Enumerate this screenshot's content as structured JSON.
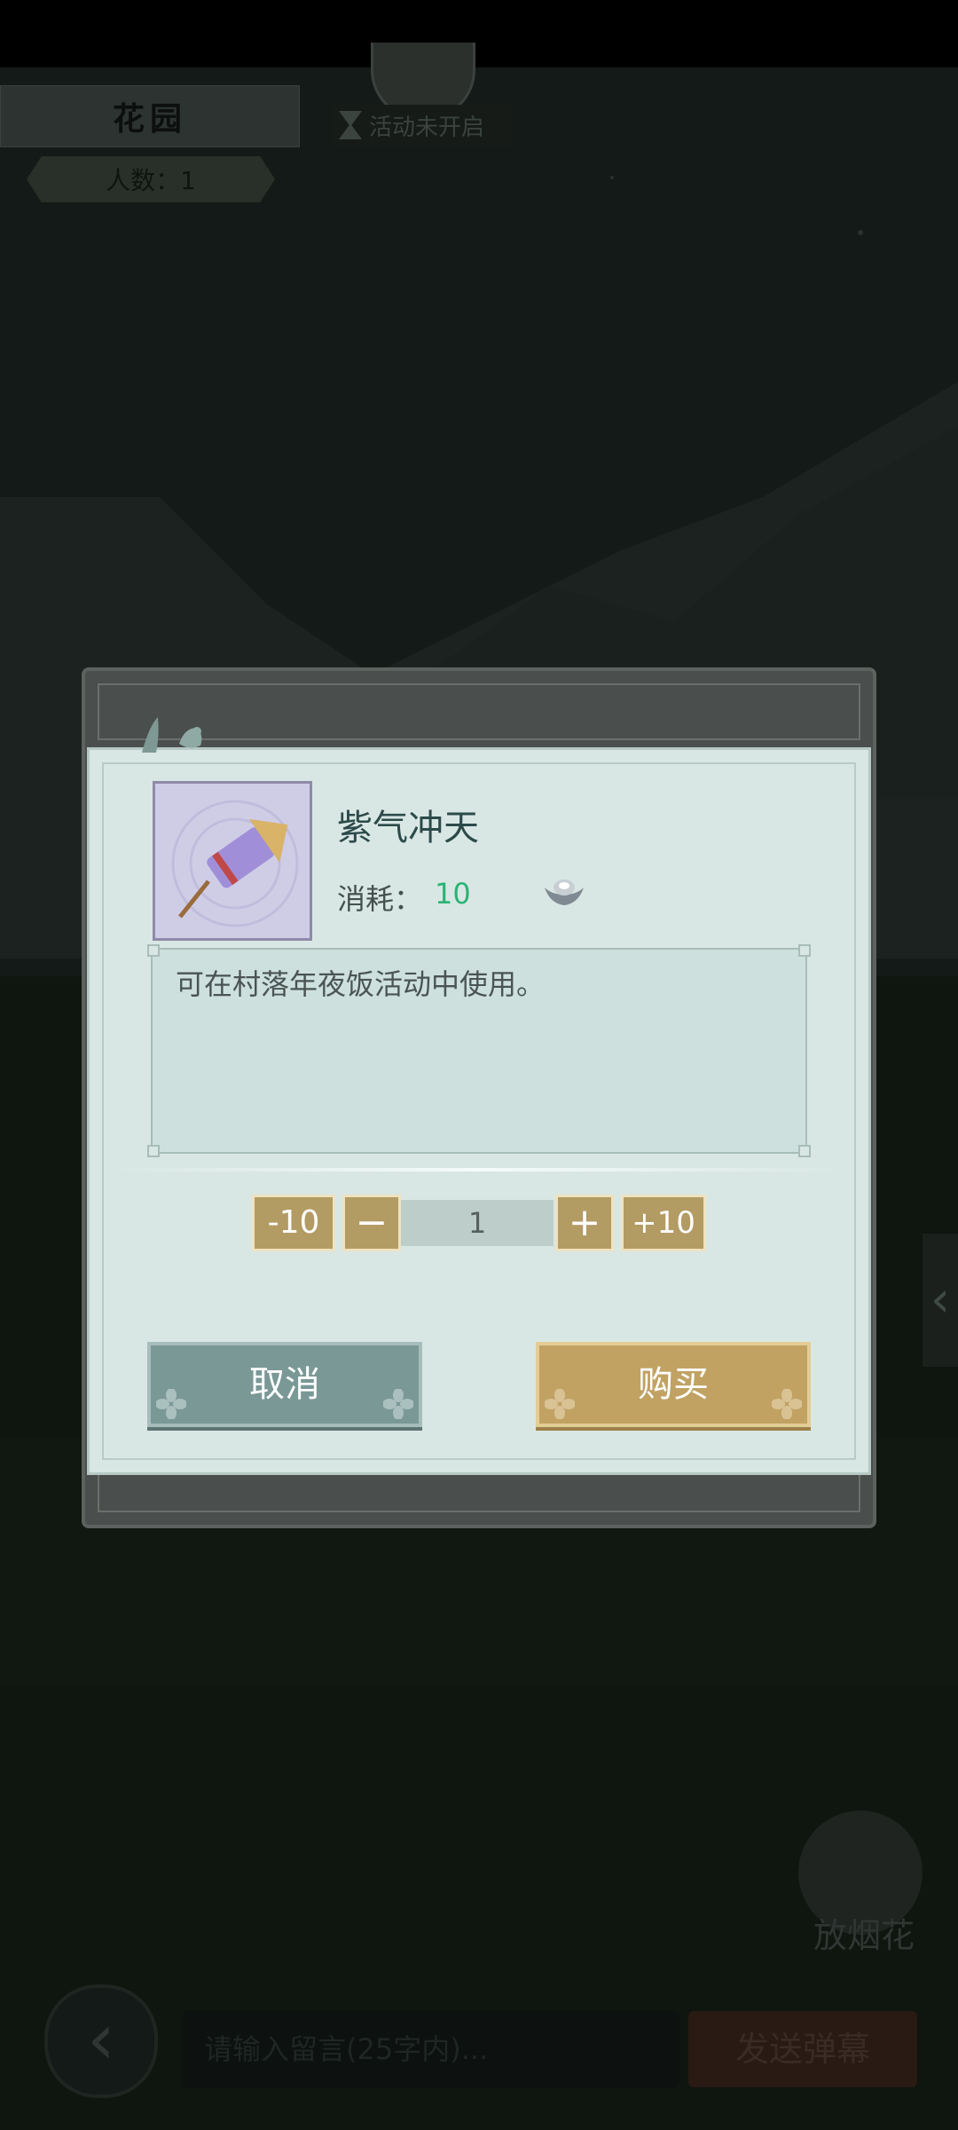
{
  "hud": {
    "place_name": "花园",
    "people_count": "人数：1",
    "activity_status": "活动未开启",
    "fireworks_label": "放烟花",
    "message_placeholder": "请输入留言(25字内)...",
    "send_label": "发送弹幕"
  },
  "dialog": {
    "item_name": "紫气冲天",
    "cost_label": "消耗：",
    "cost_value": "10",
    "description": "可在村落年夜饭活动中使用。",
    "minus10_label": "-10",
    "minus1_label": "−",
    "quantity": "1",
    "plus1_label": "+",
    "plus10_label": "+10",
    "cancel_label": "取消",
    "buy_label": "购买"
  },
  "icons": {
    "item": "purple-firework-rocket-icon",
    "currency": "silver-ingot-icon",
    "chat": "chat-bubble-icon",
    "back": "back-arrow-icon",
    "fireworks": "firework-icon"
  },
  "colors": {
    "cost_value": "#2bb374",
    "buy_button": "#c1a263",
    "cancel_button": "#7a9896",
    "dialog_bg": "#d9e7e4"
  }
}
